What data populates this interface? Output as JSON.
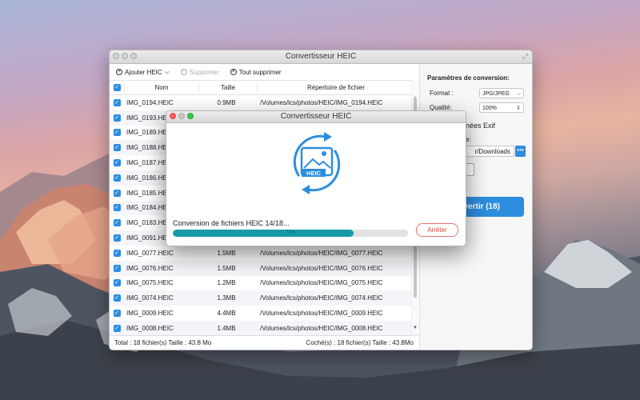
{
  "window": {
    "title": "Convertisseur HEIC",
    "toolbar": {
      "add_label": "Ajouter HEIC",
      "delete_label": "Supprimer",
      "delete_all_label": "Tout supprimer"
    },
    "table": {
      "headers": {
        "name": "Nom",
        "size": "Taille",
        "dir": "Répertoire de fichier"
      },
      "rows": [
        {
          "name": "IMG_0194.HEIC",
          "size": "0.9MB",
          "dir": "/Volumes/lcs/photos/HEIC/IMG_0194.HEIC"
        },
        {
          "name": "IMG_0193.HEIC",
          "size": "",
          "dir": ""
        },
        {
          "name": "IMG_0189.HEIC",
          "size": "",
          "dir": ""
        },
        {
          "name": "IMG_0188.HEIC",
          "size": "",
          "dir": ""
        },
        {
          "name": "IMG_0187.HEIC",
          "size": "",
          "dir": ""
        },
        {
          "name": "IMG_0186.HEIC",
          "size": "",
          "dir": ""
        },
        {
          "name": "IMG_0185.HEIC",
          "size": "",
          "dir": ""
        },
        {
          "name": "IMG_0184.HEIC",
          "size": "",
          "dir": ""
        },
        {
          "name": "IMG_0183.HEIC",
          "size": "",
          "dir": ""
        },
        {
          "name": "IMG_0091.HEIC",
          "size": "",
          "dir": ""
        },
        {
          "name": "IMG_0077.HEIC",
          "size": "1.5MB",
          "dir": "/Volumes/lcs/photos/HEIC/IMG_0077.HEIC"
        },
        {
          "name": "IMG_0076.HEIC",
          "size": "1.5MB",
          "dir": "/Volumes/lcs/photos/HEIC/IMG_0076.HEIC"
        },
        {
          "name": "IMG_0075.HEIC",
          "size": "1.2MB",
          "dir": "/Volumes/lcs/photos/HEIC/IMG_0075.HEIC"
        },
        {
          "name": "IMG_0074.HEIC",
          "size": "1.3MB",
          "dir": "/Volumes/lcs/photos/HEIC/IMG_0074.HEIC"
        },
        {
          "name": "IMG_0009.HEIC",
          "size": "4.4MB",
          "dir": "/Volumes/lcs/photos/HEIC/IMG_0009.HEIC"
        },
        {
          "name": "IMG_0008.HEIC",
          "size": "1.4MB",
          "dir": "/Volumes/lcs/photos/HEIC/IMG_0008.HEIC"
        }
      ]
    },
    "footer": {
      "total": "Total : 18 fichier(s) Taille : 43.8 Mo",
      "checked": "Coché(s) : 18 fichier(s) Taille : 43.8Mo"
    },
    "panel": {
      "title": "Paramètres de conversion:",
      "format_label": "Format :",
      "format_value": "JPG/JPEG",
      "quality_label": "Qualité:",
      "quality_value": "100%",
      "exif_label": "données Exif",
      "output_label": "sortie:",
      "output_path": "r/Downloads",
      "browse_label": "•••",
      "convert_label": "vertir (18)"
    }
  },
  "dialog": {
    "title": "Convertisseur HEIC",
    "icon_label": "HEIC",
    "status": "Conversion de fichiers HEIC 14/18...",
    "progress_percent": 77,
    "progress_text": "77%",
    "stop_label": "Arrêter"
  },
  "colors": {
    "accent": "#2d8ddf",
    "progress": "#159aa8",
    "stop": "#e0453b"
  }
}
